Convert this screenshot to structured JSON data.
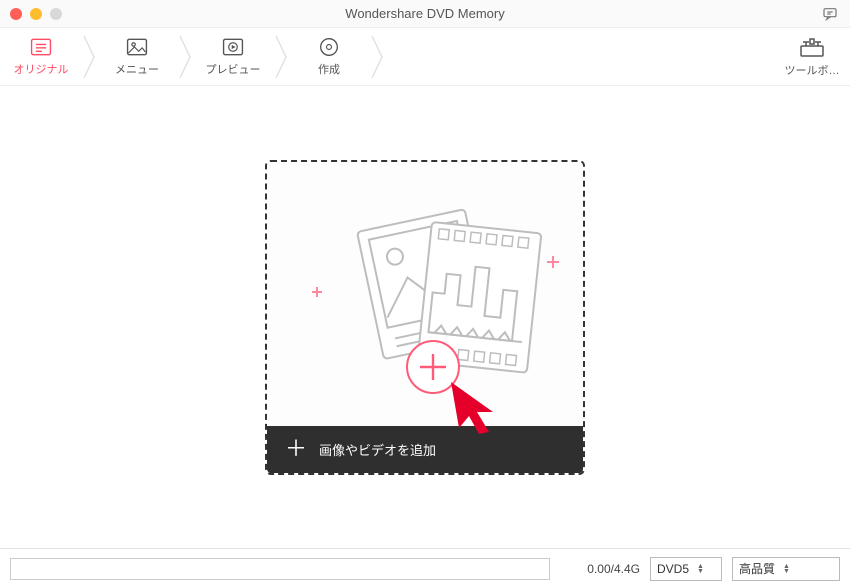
{
  "title": "Wondershare DVD Memory",
  "nav": {
    "steps": [
      {
        "label": "オリジナル"
      },
      {
        "label": "メニュー"
      },
      {
        "label": "プレビュー"
      },
      {
        "label": "作成"
      }
    ],
    "toolbox_label": "ツールボ…"
  },
  "dropzone": {
    "add_label": "画像やビデオを追加"
  },
  "footer": {
    "size_text": "0.00/4.4G",
    "disc_type": "DVD5",
    "quality": "高品質"
  }
}
